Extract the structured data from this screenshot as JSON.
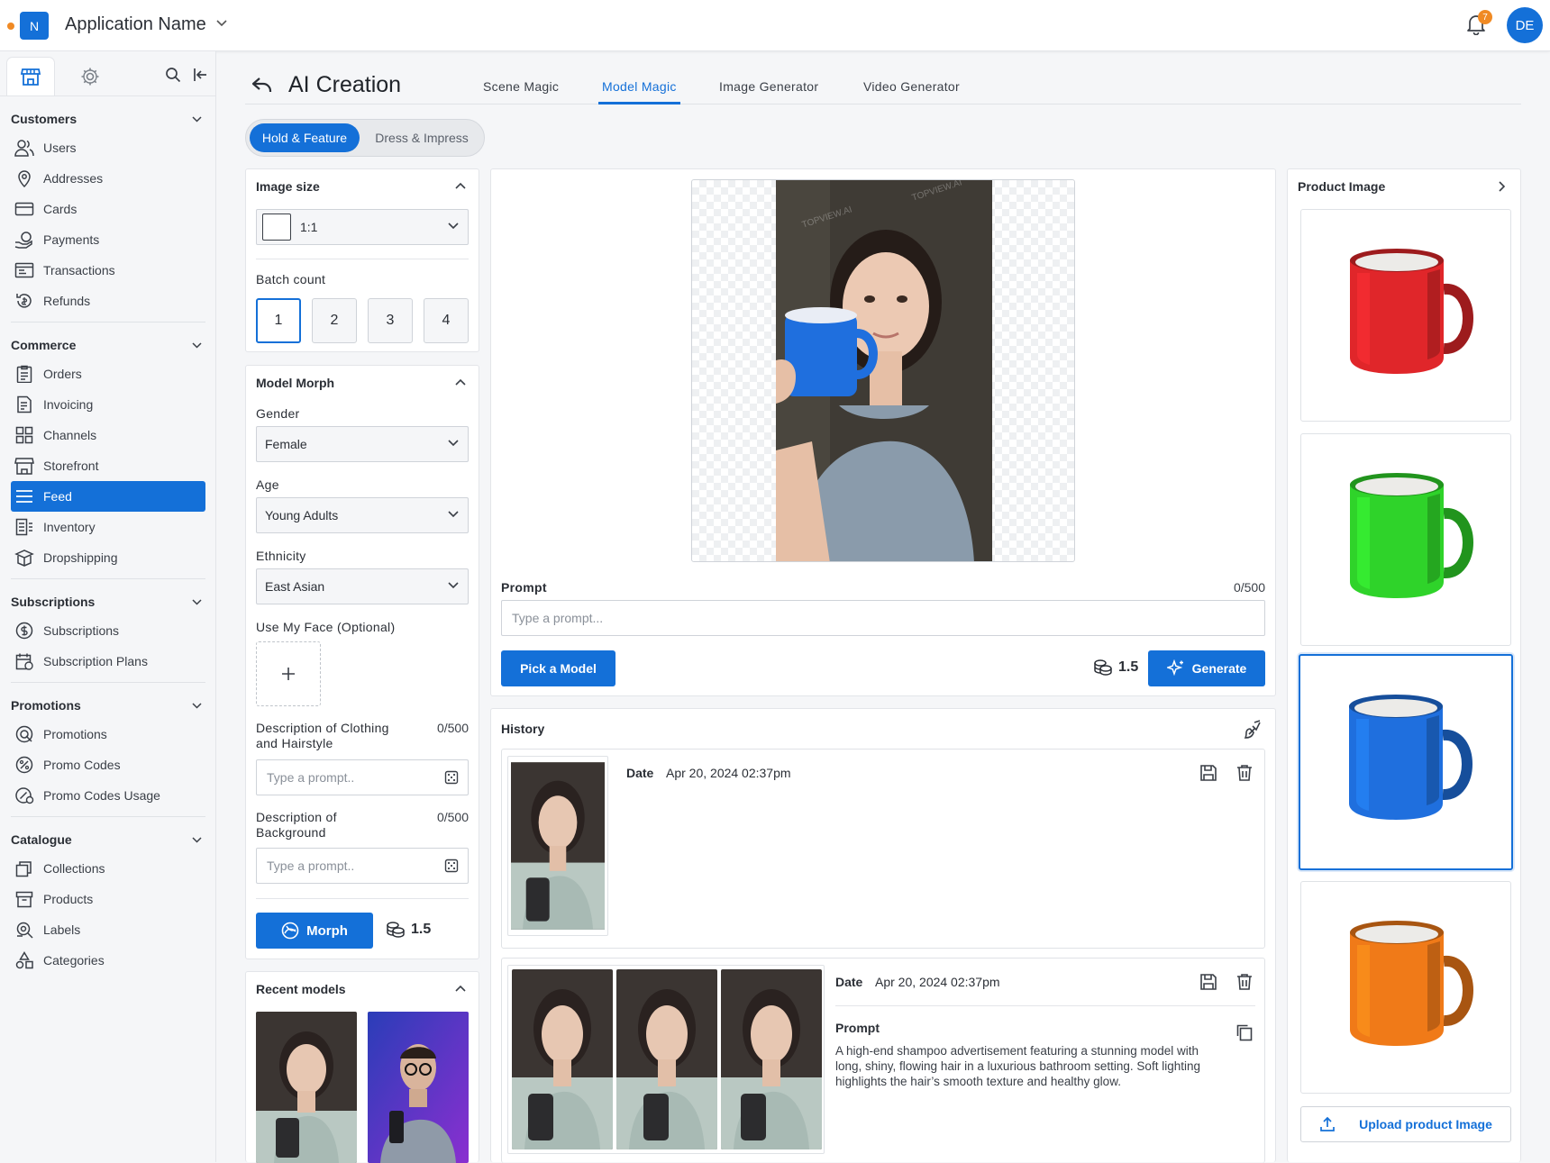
{
  "app": {
    "logo_letter": "N",
    "name": "Application Name",
    "notifications": "7",
    "avatar_initials": "DE"
  },
  "sidebar": {
    "sections": [
      {
        "title": "Customers",
        "items": [
          "Users",
          "Addresses",
          "Cards",
          "Payments",
          "Transactions",
          "Refunds"
        ]
      },
      {
        "title": "Commerce",
        "items": [
          "Orders",
          "Invoicing",
          "Channels",
          "Storefront",
          "Feed",
          "Inventory",
          "Dropshipping"
        ]
      },
      {
        "title": "Subscriptions",
        "items": [
          "Subscriptions",
          "Subscription Plans"
        ]
      },
      {
        "title": "Promotions",
        "items": [
          "Promotions",
          "Promo Codes",
          "Promo Codes Usage"
        ]
      },
      {
        "title": "Catalogue",
        "items": [
          "Collections",
          "Products",
          "Labels",
          "Categories"
        ]
      }
    ],
    "active_item": "Feed"
  },
  "page": {
    "title": "AI Creation",
    "tabs": [
      "Scene Magic",
      "Model Magic",
      "Image Generator",
      "Video Generator"
    ],
    "active_tab": "Model Magic",
    "segments": [
      "Hold & Feature",
      "Dress & Impress"
    ]
  },
  "left_panel": {
    "image_size": {
      "title": "Image size",
      "value": "1:1"
    },
    "batch": {
      "title": "Batch count",
      "options": [
        "1",
        "2",
        "3",
        "4"
      ],
      "selected": "1"
    },
    "morph": {
      "title": "Model Morph",
      "gender_label": "Gender",
      "gender": "Female",
      "age_label": "Age",
      "age": "Young Adults",
      "ethnicity_label": "Ethnicity",
      "ethnicity": "East Asian",
      "face_label": "Use My Face (Optional)",
      "clothing_label": "Description of Clothing and Hairstyle",
      "clothing_count": "0/500",
      "clothing_placeholder": "Type a prompt..",
      "background_label": "Description of Background",
      "background_count": "0/500",
      "background_placeholder": "Type a prompt..",
      "morph_button": "Morph",
      "cost": "1.5"
    },
    "recent": {
      "title": "Recent models"
    }
  },
  "center": {
    "prompt_label": "Prompt",
    "prompt_count": "0/500",
    "prompt_placeholder": "Type a prompt...",
    "pick_model": "Pick a Model",
    "cost": "1.5",
    "generate": "Generate",
    "watermark": "TOPVIEW.AI",
    "history": {
      "title": "History",
      "entries": [
        {
          "date_label": "Date",
          "date": "Apr 20, 2024 02:37pm"
        },
        {
          "date_label": "Date",
          "date": "Apr 20, 2024 02:37pm",
          "prompt_label": "Prompt",
          "prompt": "A high-end shampoo advertisement featuring a stunning model with long, shiny, flowing hair in a luxurious bathroom setting. Soft lighting highlights the hair’s smooth texture and healthy glow."
        }
      ]
    }
  },
  "right_panel": {
    "title": "Product Image",
    "mug_colors": [
      "#e0262a",
      "#2fd32a",
      "#1f6fde",
      "#f07a18"
    ],
    "selected_index": 2,
    "upload": "Upload product Image"
  },
  "colors": {
    "accent": "#1470d8",
    "badge": "#f08a24"
  }
}
